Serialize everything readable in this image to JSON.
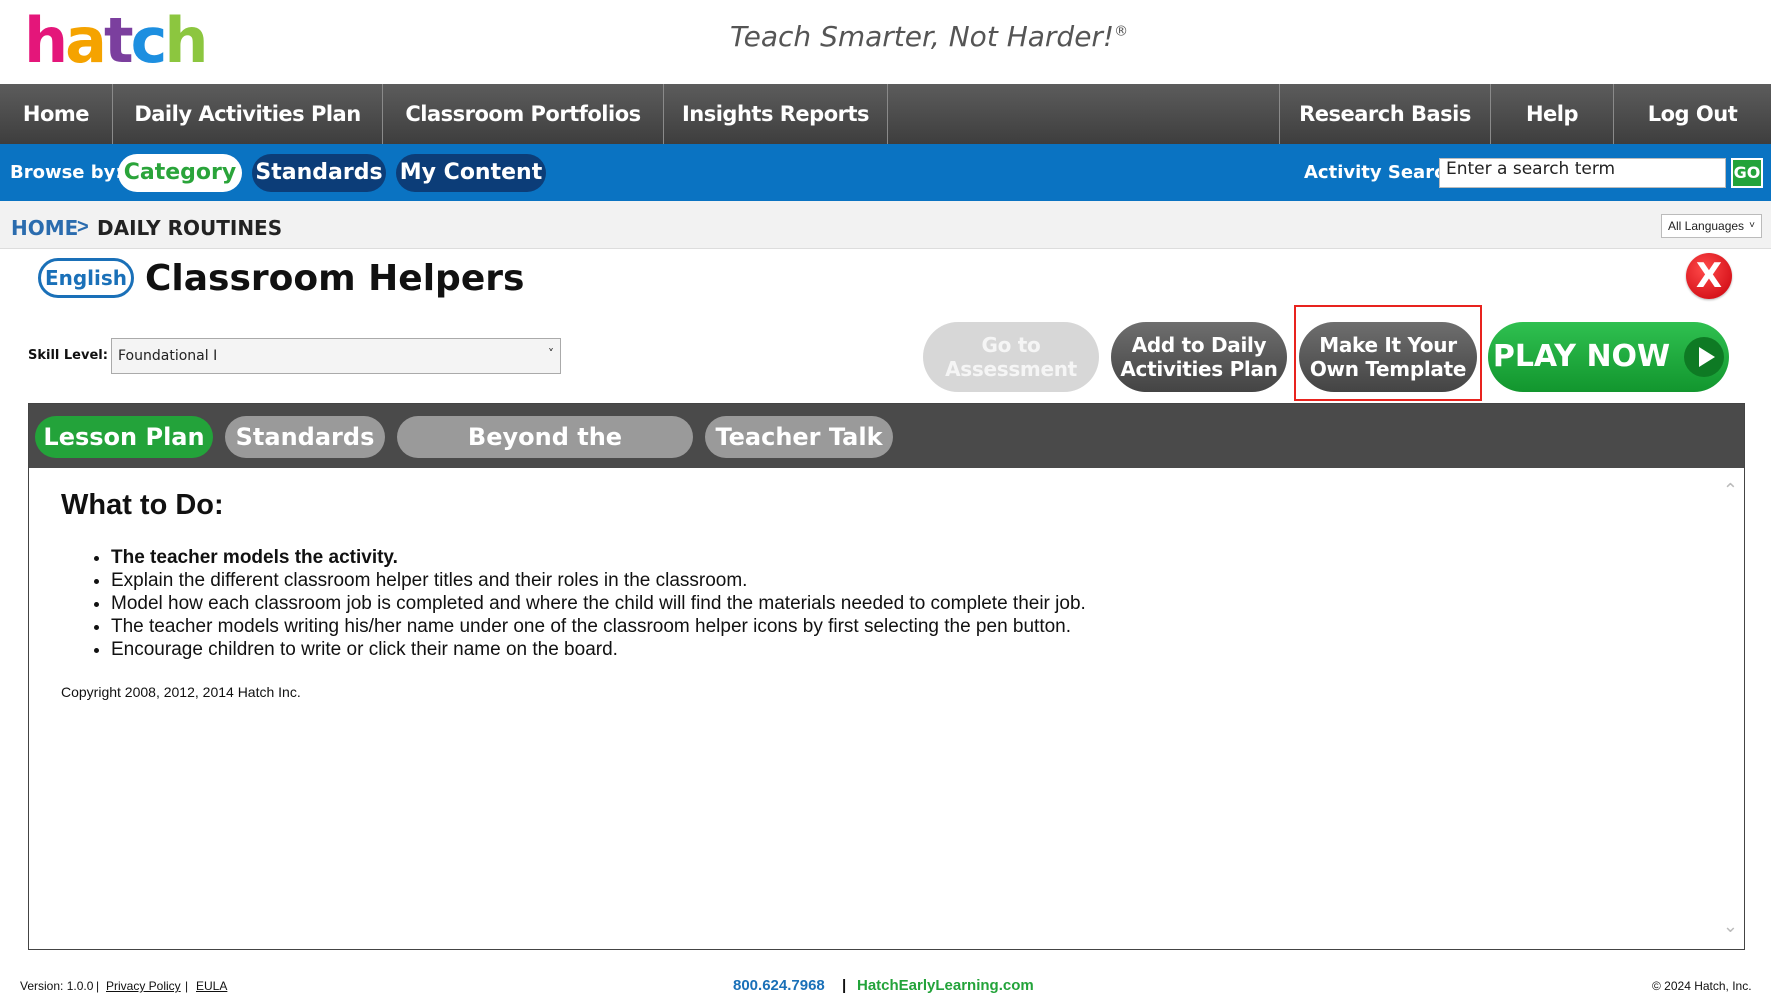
{
  "brand": {
    "logo_letters": [
      "h",
      "a",
      "t",
      "c",
      "h"
    ],
    "logo_colors": [
      "#e4167a",
      "#f5a300",
      "#7b3f9e",
      "#1d8fe0",
      "#8cc63f"
    ],
    "tagline": "Teach Smarter, Not Harder!",
    "tagline_mark": "®"
  },
  "nav": {
    "items": [
      "Home",
      "Daily Activities Plan",
      "Classroom Portfolios",
      "Insights Reports",
      "Research Basis",
      "Help",
      "Log Out"
    ]
  },
  "browse": {
    "label": "Browse by:",
    "options": [
      "Category",
      "Standards",
      "My Content"
    ],
    "active": "Category",
    "search_label": "Activity Search:",
    "search_value": "Enter a search term",
    "go_label": "GO"
  },
  "breadcrumb": {
    "home": "HOME",
    "separator": ">",
    "current": "DAILY ROUTINES"
  },
  "language_select": {
    "value": "All Languages",
    "chevron": "˅"
  },
  "activity": {
    "language_badge": "English",
    "title": "Classroom Helpers",
    "close_label": "X",
    "skill_label": "Skill Level:",
    "skill_value": "Foundational I",
    "skill_chevron": "˅"
  },
  "actions": {
    "go_to_assessment": [
      "Go to",
      "Assessment"
    ],
    "add_to_plan": [
      "Add to Daily",
      "Activities Plan"
    ],
    "make_template": [
      "Make It Your",
      "Own Template"
    ],
    "play_now": "PLAY NOW"
  },
  "tabs": [
    "Lesson Plan",
    "Standards",
    "Beyond the Technology",
    "Teacher Talk"
  ],
  "lesson": {
    "heading": "What to Do:",
    "items": [
      "The teacher models the activity.",
      "Explain the different classroom helper titles and their roles in the classroom.",
      "Model how each classroom job is completed and where the child will find the materials needed to complete their job.",
      "The teacher models writing his/her name under one of the classroom helper icons by first selecting the pen button.",
      "Encourage children to write or click their name on the board."
    ],
    "copyright": "Copyright 2008, 2012, 2014 Hatch Inc."
  },
  "footer": {
    "version": "Version: 1.0.0",
    "bar": "|",
    "privacy": "Privacy Policy",
    "eula": "EULA",
    "phone": "800.624.7968",
    "sep": "|",
    "website": "HatchEarlyLearning.com",
    "copyright": "© 2024 Hatch, Inc."
  }
}
